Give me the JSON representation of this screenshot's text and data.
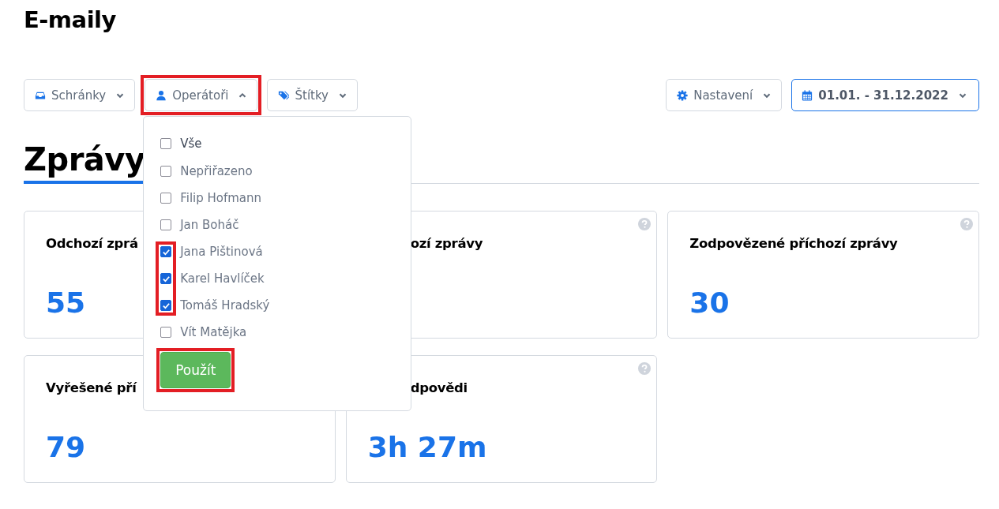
{
  "page_title": "E-maily",
  "toolbar_left": [
    {
      "kind": "inbox",
      "label": "Schránky",
      "expanded": false
    },
    {
      "kind": "user",
      "label": "Operátoři",
      "expanded": true
    },
    {
      "kind": "tags",
      "label": "Štítky",
      "expanded": false
    }
  ],
  "toolbar_right": [
    {
      "kind": "settings",
      "label": "Nastavení",
      "expanded": false
    },
    {
      "kind": "date",
      "label": "01.01. - 31.12.2022",
      "expanded": false
    }
  ],
  "section_heading": "Zprávy",
  "operators_menu": {
    "all_option": {
      "label": "Vše",
      "checked": false
    },
    "options": [
      {
        "label": "Nepřiřazeno",
        "checked": false
      },
      {
        "label": "Filip Hofmann",
        "checked": false
      },
      {
        "label": "Jan Boháč",
        "checked": false
      },
      {
        "label": "Jana Pištinová",
        "checked": true
      },
      {
        "label": "Karel Havlíček",
        "checked": true
      },
      {
        "label": "Tomáš Hradský",
        "checked": true
      },
      {
        "label": "Vít Matějka",
        "checked": false
      }
    ],
    "apply_button": "Použít"
  },
  "cards": [
    {
      "title": "Odchozí zprá",
      "title_covered": false,
      "value": "55",
      "help": false
    },
    {
      "title": "ozí zprávy",
      "title_covered": true,
      "help": true
    },
    {
      "title": "Zodpovězené příchozí zprávy",
      "title_covered": false,
      "value": "30",
      "help": true
    },
    {
      "title": "Vyřešené pří",
      "title_covered": false,
      "value": "79",
      "help": false
    },
    {
      "title": "dpovědi",
      "title_covered": true,
      "value": "3h 27m",
      "help": true
    }
  ],
  "annotations": [
    {
      "kind": "operators_button"
    },
    {
      "kind": "checked_boxes"
    },
    {
      "kind": "apply_button"
    }
  ]
}
